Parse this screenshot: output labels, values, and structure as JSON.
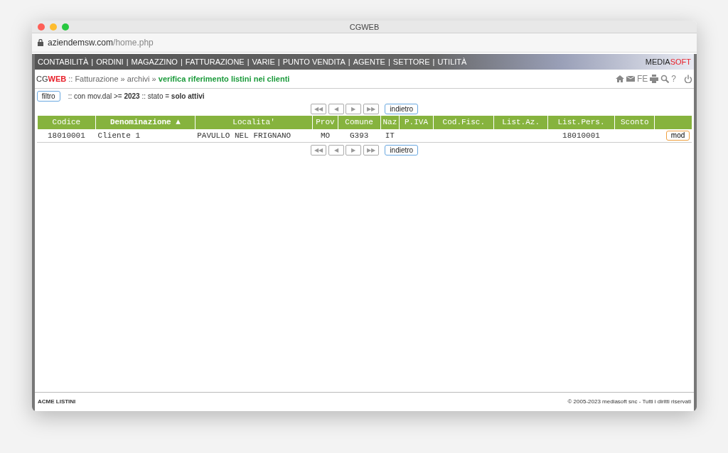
{
  "window": {
    "title": "CGWEB",
    "url_host": "aziendemsw.com",
    "url_path": "/home.php"
  },
  "menu_separator": "|",
  "menu": [
    "CONTABILITÀ",
    "ORDINI",
    "MAGAZZINO",
    "FATTURAZIONE",
    "VARIE",
    "PUNTO VENDITA",
    "AGENTE",
    "SETTORE",
    "UTILITÀ"
  ],
  "brand": {
    "part1": "MEDIA",
    "part2": "SOFT"
  },
  "breadcrumb": {
    "app1": "CG",
    "app2": "WEB",
    "path": ":: Fatturazione » archivi »",
    "current": "verifica riferimento listini nei clienti"
  },
  "toolbar": [
    {
      "kind": "home"
    },
    {
      "kind": "mail"
    },
    {
      "kind": "text",
      "label": "FE"
    },
    {
      "kind": "print"
    },
    {
      "kind": "search"
    },
    {
      "kind": "text",
      "label": "?"
    },
    {
      "kind": "power"
    }
  ],
  "filter": {
    "button": "filtro",
    "summary": ":: con mov.dal >= **2023** :: stato = **solo attivi**"
  },
  "pager": {
    "buttons": [
      "◀◀",
      "◀",
      "▶",
      "▶▶"
    ],
    "back": "indietro"
  },
  "table": {
    "columns": [
      {
        "label": "Codice",
        "sorted": false
      },
      {
        "label": "Denominazione ▲",
        "sorted": true
      },
      {
        "label": "Localita'",
        "sorted": false
      },
      {
        "label": "Prov",
        "sorted": false
      },
      {
        "label": "Comune",
        "sorted": false
      },
      {
        "label": "Naz",
        "sorted": false
      },
      {
        "label": "P.IVA",
        "sorted": false
      },
      {
        "label": "Cod.Fisc.",
        "sorted": false
      },
      {
        "label": "List.Az.",
        "sorted": false
      },
      {
        "label": "List.Pers.",
        "sorted": false
      },
      {
        "label": "Sconto",
        "sorted": false
      }
    ],
    "rows": [
      {
        "cells": [
          "18010001",
          "Cliente 1",
          "PAVULLO NEL FRIGNANO",
          "MO",
          "G393",
          "IT",
          null,
          null,
          null,
          "18010001",
          null
        ],
        "action": "mod"
      }
    ]
  },
  "pager_bottom": {
    "buttons": [
      "◀◀",
      "◀",
      "▶",
      "▶▶"
    ],
    "back": "indietro"
  },
  "footer": {
    "left": "ACME LISTINI",
    "right": "© 2005-2023 mediasoft snc - Tutti i diritti riservati"
  }
}
